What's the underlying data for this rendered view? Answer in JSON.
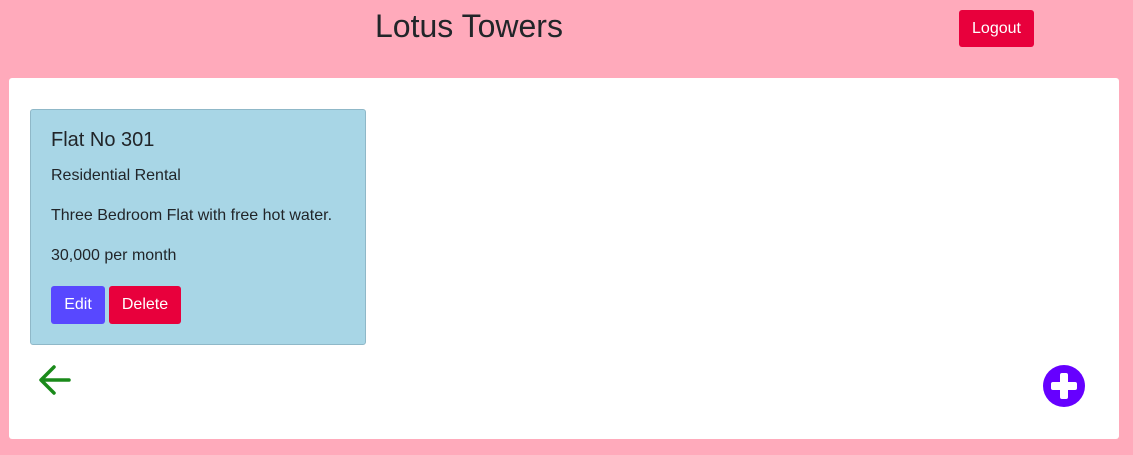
{
  "header": {
    "title": "Lotus Towers",
    "logout_label": "Logout"
  },
  "listing": {
    "title": "Flat No 301",
    "type": "Residential Rental",
    "description": "Three Bedroom Flat with free hot water.",
    "price": "30,000 per month",
    "edit_label": "Edit",
    "delete_label": "Delete"
  },
  "icons": {
    "back": "arrow-left-icon",
    "add": "plus-circle-icon"
  },
  "colors": {
    "background": "#ffaabb",
    "card": "#a8d6e6",
    "danger": "#e8003c",
    "primary": "#5848ff",
    "back_arrow": "#1a8a1a",
    "add_button": "#6600ff"
  }
}
